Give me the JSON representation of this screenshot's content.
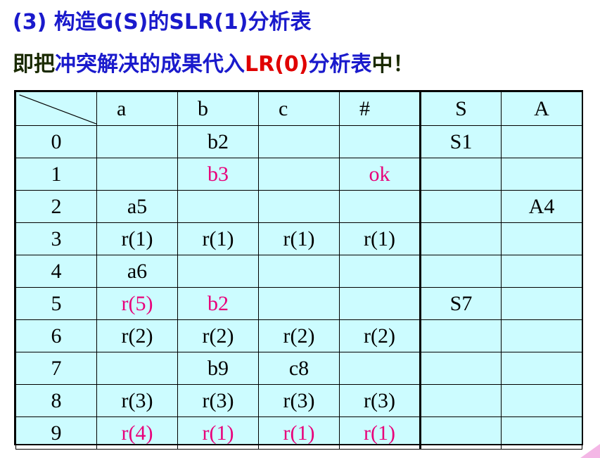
{
  "heading": "(3) 构造G(S)的SLR(1)分析表",
  "subheading": {
    "part1": "即把",
    "part2": "冲突解决的成果代入",
    "part3": "LR(0)",
    "part4": "分析表",
    "part5": "中！"
  },
  "table": {
    "columns": [
      "a",
      "b",
      "c",
      "#",
      "S",
      "A"
    ],
    "rows": [
      {
        "state": "0",
        "cells": [
          "",
          "b2",
          "",
          "",
          "S1",
          ""
        ]
      },
      {
        "state": "1",
        "cells": [
          "",
          "b3",
          "",
          "ok",
          "",
          ""
        ]
      },
      {
        "state": "2",
        "cells": [
          "a5",
          "",
          "",
          "",
          "",
          "A4"
        ]
      },
      {
        "state": "3",
        "cells": [
          "r(1)",
          "r(1)",
          "r(1)",
          "r(1)",
          "",
          ""
        ]
      },
      {
        "state": "4",
        "cells": [
          "a6",
          "",
          "",
          "",
          "",
          ""
        ]
      },
      {
        "state": "5",
        "cells": [
          "r(5)",
          "b2",
          "",
          "",
          "S7",
          ""
        ]
      },
      {
        "state": "6",
        "cells": [
          "r(2)",
          "r(2)",
          "r(2)",
          "r(2)",
          "",
          ""
        ]
      },
      {
        "state": "7",
        "cells": [
          "",
          "b9",
          "c8",
          "",
          "",
          ""
        ]
      },
      {
        "state": "8",
        "cells": [
          "r(3)",
          "r(3)",
          "r(3)",
          "r(3)",
          "",
          ""
        ]
      },
      {
        "state": "9",
        "cells": [
          "r(4)",
          "r(1)",
          "r(1)",
          "r(1)",
          "",
          ""
        ]
      }
    ]
  },
  "colors": {
    "background": "#ccfcff",
    "highlight": "#e8007a",
    "title_blue": "#1a1acc",
    "accent_red": "#e00000"
  }
}
